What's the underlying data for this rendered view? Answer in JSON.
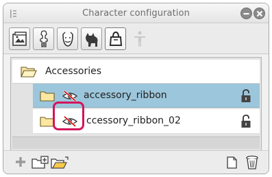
{
  "window": {
    "title": "Character configuration"
  },
  "toolbar": {
    "buttons": [
      {
        "name": "template",
        "icon": "frame-template-icon"
      },
      {
        "name": "body",
        "icon": "body-figure-icon"
      },
      {
        "name": "face",
        "icon": "face-icon"
      },
      {
        "name": "animal",
        "icon": "animal-icon"
      },
      {
        "name": "accessories",
        "icon": "accessory-bag-icon",
        "active": true
      },
      {
        "name": "pose",
        "icon": "pose-figure-icon",
        "disabled": true
      }
    ]
  },
  "tree": {
    "folder": {
      "label": "Accessories",
      "icon": "folder-open-icon"
    },
    "items": [
      {
        "label": "accessory_ribbon",
        "selected": true,
        "visible": false,
        "locked": true
      },
      {
        "label": "ccessory_ribbon_02",
        "selected": false,
        "visible": false,
        "locked": true
      }
    ]
  },
  "bottom": {
    "icons": [
      "add-icon",
      "new-folder-icon",
      "open-folder-icon",
      "duplicate-icon",
      "trash-icon"
    ]
  },
  "colors": {
    "selection": "#9cc6db",
    "highlight": "#d4145a"
  }
}
